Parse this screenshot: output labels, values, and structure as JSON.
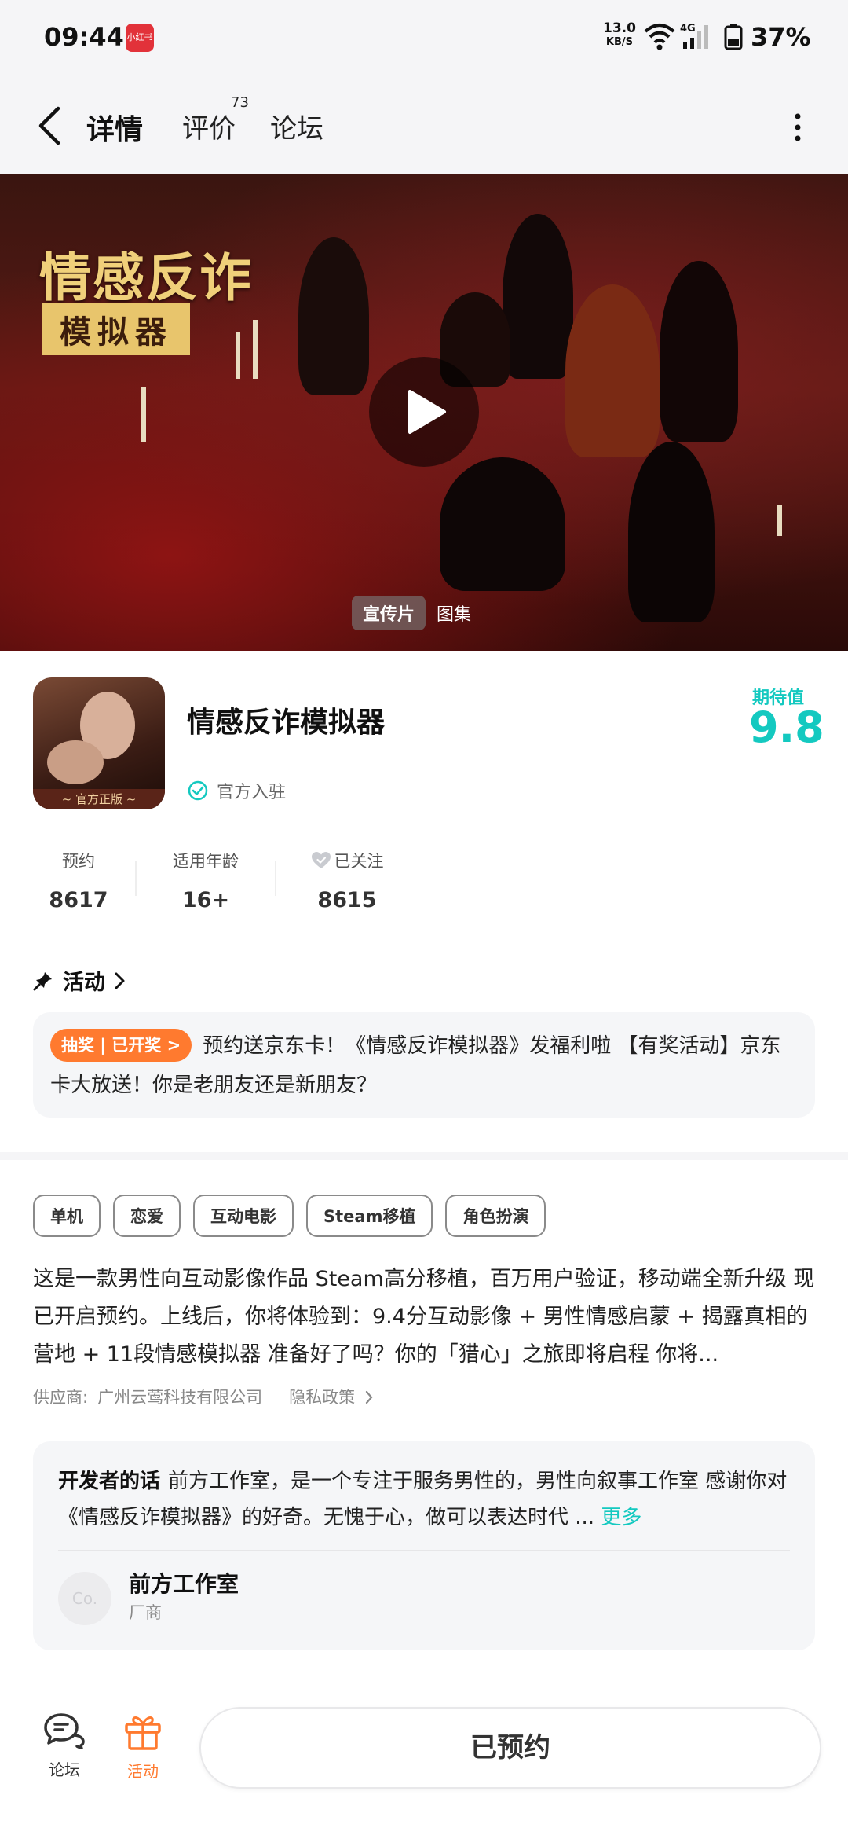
{
  "status_bar": {
    "time": "09:44",
    "app_icon_label": "小红书",
    "net_speed_value": "13.0",
    "net_speed_unit": "KB/S",
    "battery_percent": "37%",
    "icons": [
      "app-notification-icon",
      "wifi-icon",
      "signal-4g-icon",
      "battery-icon"
    ]
  },
  "header": {
    "tabs": [
      {
        "label": "详情",
        "active": true
      },
      {
        "label": "评价",
        "badge": "73"
      },
      {
        "label": "论坛"
      }
    ],
    "icons": [
      "back-arrow-icon",
      "more-vertical-icon"
    ]
  },
  "banner": {
    "title": "情感反诈",
    "subtitle": "模拟器",
    "media_tabs": [
      {
        "label": "宣传片",
        "active": true
      },
      {
        "label": "图集"
      }
    ],
    "icons": [
      "play-icon"
    ]
  },
  "app": {
    "name": "情感反诈模拟器",
    "icon_ribbon": "~ 官方正版 ~",
    "official_label": "官方入驻",
    "expect_label": "期待值",
    "expect_value": "9.8",
    "stats": [
      {
        "label": "预约",
        "value": "8617"
      },
      {
        "label": "适用年龄",
        "value": "16+"
      },
      {
        "label": "已关注",
        "value": "8615",
        "icon": "heart-check-icon"
      }
    ]
  },
  "activity": {
    "title": "活动",
    "tag": "抽奖 | 已开奖 >",
    "text": "预约送京东卡！《情感反诈模拟器》发福利啦 【有奖活动】京东卡大放送！你是老朋友还是新朋友？"
  },
  "tags": [
    "单机",
    "恋爱",
    "互动电影",
    "Steam移植",
    "角色扮演"
  ],
  "description": "这是一款男性向互动影像作品 Steam高分移植，百万用户验证，移动端全新升级 现已开启预约。上线后，你将体验到：9.4分互动影像 + 男性情感启蒙 + 揭露真相的营地 + 11段情感模拟器 准备好了吗？你的「猎心」之旅即将启程 你将...",
  "supplier": {
    "label": "供应商:",
    "name": "广州云莺科技有限公司",
    "privacy": "隐私政策"
  },
  "developer": {
    "lead": "开发者的话",
    "text": "前方工作室，是一个专注于服务男性的，男性向叙事工作室 感谢你对《情感反诈模拟器》的好奇。无愧于心，做可以表达时代 ...",
    "more": "更多",
    "avatar_text": "Co.",
    "name": "前方工作室",
    "role": "厂商"
  },
  "bottom_bar": {
    "forum_label": "论坛",
    "activity_label": "活动",
    "reserve_label": "已预约",
    "accent_color": "#ff7a2f",
    "brand_color": "#14c9c0"
  }
}
